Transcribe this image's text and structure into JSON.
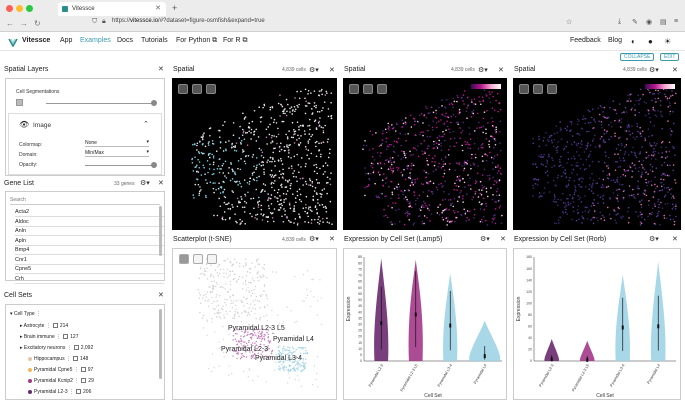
{
  "browser": {
    "tab_title": "Vitessce",
    "url_host": "vitessce.io",
    "url_path": "/#?dataset=figure-osmfish&expand=true",
    "tab_close": "✕",
    "new_tab": "+"
  },
  "nav": {
    "brand": "Vitessce",
    "items": [
      "App",
      "Examples",
      "Docs",
      "Tutorials",
      "For Python ⧉",
      "For R ⧉"
    ],
    "right": [
      "Feedback",
      "Blog"
    ]
  },
  "actions": {
    "collapse": "COLLAPSE",
    "edit": "EDIT"
  },
  "spatial_layers": {
    "title": "Spatial Layers",
    "segmentations_label": "Cell Segmentations",
    "image_label": "Image",
    "colormap_label": "Colormap:",
    "colormap_value": "None",
    "domain_label": "Domain:",
    "domain_value": "Min/Max",
    "opacity_label": "Opacity:"
  },
  "gene_list": {
    "title": "Gene List",
    "count": "33 genes",
    "search_placeholder": "Search",
    "genes": [
      "Acta2",
      "Aldoc",
      "Anln",
      "Apln",
      "Bmp4",
      "Cnr1",
      "Cpne5",
      "Crh"
    ]
  },
  "cell_sets": {
    "title": "Cell Sets",
    "root": "Cell Type",
    "items": [
      {
        "name": "Astrocyte",
        "count": "214",
        "level": 1,
        "color": "#888888"
      },
      {
        "name": "Brain immune",
        "count": "127",
        "level": 1,
        "color": "#888888"
      },
      {
        "name": "Excitatory neurons",
        "count": "2,092",
        "level": 1,
        "color": "#888888"
      },
      {
        "name": "Hippocampus",
        "count": "148",
        "level": 2,
        "color": "#e3c7a5"
      },
      {
        "name": "Pyramidal Cpne5",
        "count": "97",
        "level": 2,
        "color": "#f0b65a"
      },
      {
        "name": "Pyramidal Kcnip2",
        "count": "29",
        "level": 2,
        "color": "#a3388a"
      },
      {
        "name": "Pyramidal L2-3",
        "count": "206",
        "level": 2,
        "color": "#6a2a6e"
      }
    ]
  },
  "spatial_views": [
    {
      "title": "Spatial",
      "count": "4,839 cells"
    },
    {
      "title": "Spatial",
      "count": "4,839 cells"
    },
    {
      "title": "Spatial",
      "count": "4,839 cells"
    }
  ],
  "scatterplot": {
    "title": "Scatterplot (t-SNE)",
    "count": "4,839 cells",
    "cluster_labels": [
      "Pyramidal L2-3 L5",
      "Pyramidal L4",
      "Pyramidal L2-3",
      "Pyramidal L3-4"
    ]
  },
  "violin_panels": {
    "panel_titles": [
      "Expression by Cell Set (Lamp5)",
      "Expression by Cell Set (Rorb)"
    ]
  },
  "chart_data": [
    {
      "type": "violin",
      "title": "Expression by Cell Set (Lamp5)",
      "xlabel": "Cell Set",
      "ylabel": "Expression",
      "categories": [
        "Pyramidal L2-3",
        "Pyramidal L2-3 L5",
        "Pyramidal L3-4",
        "Pyramidal L4"
      ],
      "colors": [
        "#6a2a6e",
        "#a3388a",
        "#9fd3e6",
        "#9fd3e6"
      ],
      "yticks": [
        0,
        5,
        10,
        15,
        20,
        25,
        30,
        35,
        40,
        45,
        50,
        55,
        60,
        65,
        70,
        75,
        80,
        85
      ],
      "ylim": [
        0,
        85
      ],
      "medians": [
        31,
        38,
        29,
        4
      ],
      "maxima": [
        84,
        83,
        72,
        33
      ]
    },
    {
      "type": "violin",
      "title": "Expression by Cell Set (Rorb)",
      "xlabel": "Cell Set",
      "ylabel": "Expression",
      "categories": [
        "Pyramidal L2-3",
        "Pyramidal L2-3 L5",
        "Pyramidal L3-4",
        "Pyramidal L4"
      ],
      "colors": [
        "#6a2a6e",
        "#a3388a",
        "#9fd3e6",
        "#9fd3e6"
      ],
      "yticks": [
        0,
        20,
        40,
        60,
        80,
        100,
        120,
        140,
        160,
        180
      ],
      "ylim": [
        0,
        180
      ],
      "medians": [
        3,
        2,
        58,
        60
      ],
      "maxima": [
        38,
        35,
        150,
        172
      ]
    }
  ],
  "icons": {
    "settings": "gear-icon",
    "close": "close-icon"
  }
}
